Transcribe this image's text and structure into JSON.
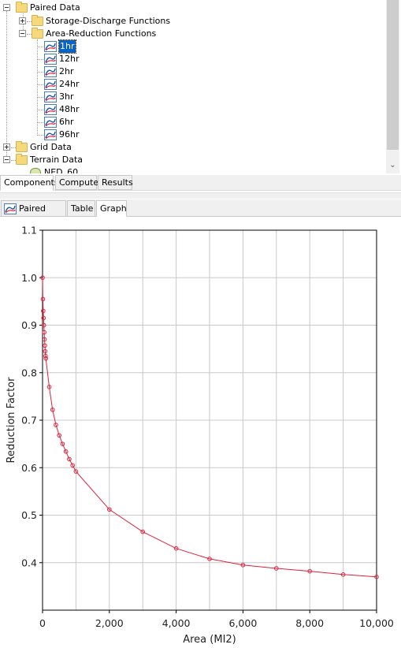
{
  "tree": {
    "paired_data": "Paired Data",
    "storage_discharge": "Storage-Discharge Functions",
    "area_reduction": "Area-Reduction Functions",
    "functions": [
      "1hr",
      "12hr",
      "2hr",
      "24hr",
      "3hr",
      "48hr",
      "6hr",
      "96hr"
    ],
    "selected_function": "1hr",
    "grid_data": "Grid Data",
    "terrain_data": "Terrain Data",
    "partial_item": "NED_60"
  },
  "bottom_tabs": [
    "Components",
    "Compute",
    "Results"
  ],
  "editor_tabs": [
    "Paired Data",
    "Table",
    "Graph"
  ],
  "colors": {
    "series": "#e0203c",
    "grid": "#c8c8c8",
    "selection": "#0a64c8"
  },
  "icons": {
    "folder": "folder-icon",
    "curve": "paired-data-curve-icon",
    "expander_plus": "expand-plus-icon",
    "expander_minus": "collapse-minus-icon"
  },
  "chart_data": {
    "type": "line",
    "xlabel": "Area (MI2)",
    "ylabel": "Reduction Factor",
    "xlim": [
      0,
      10000
    ],
    "ylim": [
      0.3,
      1.1
    ],
    "grid": true,
    "x_tick_values": [
      0,
      2000,
      4000,
      6000,
      8000,
      10000
    ],
    "x_tick_labels": [
      "0",
      "2,000",
      "4,000",
      "6,000",
      "8,000",
      "10,000"
    ],
    "y_tick_values": [
      0.4,
      0.5,
      0.6,
      0.7,
      0.8,
      0.9,
      1.0,
      1.1
    ],
    "y_tick_labels": [
      "0.4",
      "0.5",
      "0.6",
      "0.7",
      "0.8",
      "0.9",
      "1.0",
      "1.1"
    ],
    "series": [
      {
        "x": [
          0,
          10,
          20,
          30,
          40,
          50,
          60,
          70,
          80,
          90,
          100,
          200,
          300,
          400,
          500,
          600,
          700,
          800,
          900,
          1000,
          2000,
          3000,
          4000,
          5000,
          6000,
          7000,
          8000,
          9000,
          10000
        ],
        "y": [
          1.0,
          0.955,
          0.93,
          0.915,
          0.9,
          0.885,
          0.87,
          0.857,
          0.845,
          0.835,
          0.83,
          0.77,
          0.722,
          0.69,
          0.668,
          0.65,
          0.634,
          0.618,
          0.605,
          0.592,
          0.512,
          0.465,
          0.43,
          0.408,
          0.395,
          0.388,
          0.382,
          0.375,
          0.37
        ]
      }
    ]
  }
}
